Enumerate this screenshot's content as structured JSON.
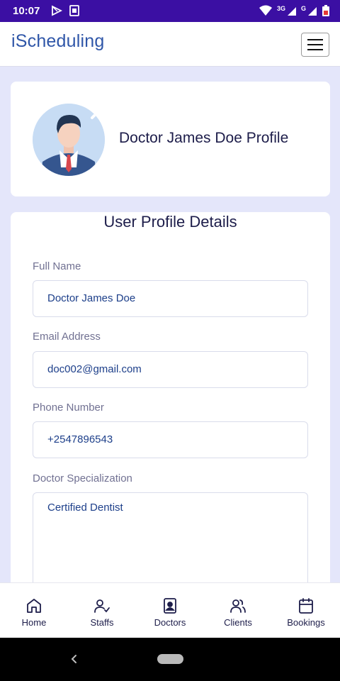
{
  "status_bar": {
    "time": "10:07",
    "network_label": "3G",
    "network_label_2": "G",
    "icons": [
      "play-store-icon",
      "sim-icon",
      "wifi-icon",
      "signal-icon",
      "battery-icon"
    ]
  },
  "app_bar": {
    "title": "iScheduling",
    "menu_icon": "hamburger-menu-icon"
  },
  "profile_card": {
    "avatar_icon": "doctor-avatar-icon",
    "title": "Doctor James Doe Profile"
  },
  "details": {
    "heading": "User Profile Details",
    "fields": [
      {
        "label": "Full Name",
        "value": "Doctor James Doe"
      },
      {
        "label": "Email Address",
        "value": "doc002@gmail.com"
      },
      {
        "label": "Phone Number",
        "value": "+2547896543"
      },
      {
        "label": "Doctor Specialization",
        "value": "Certified Dentist"
      }
    ]
  },
  "bottom_nav": {
    "items": [
      {
        "label": "Home",
        "icon": "home-icon"
      },
      {
        "label": "Staffs",
        "icon": "user-check-icon"
      },
      {
        "label": "Doctors",
        "icon": "id-badge-icon"
      },
      {
        "label": "Clients",
        "icon": "users-icon"
      },
      {
        "label": "Bookings",
        "icon": "calendar-icon"
      }
    ]
  },
  "colors": {
    "status_bar": "#3b0fa3",
    "background": "#e4e6fa",
    "title_blue": "#2f56a8",
    "text_dark": "#1d1d4a",
    "field_text": "#1d3f8a",
    "label_gray": "#717192"
  }
}
